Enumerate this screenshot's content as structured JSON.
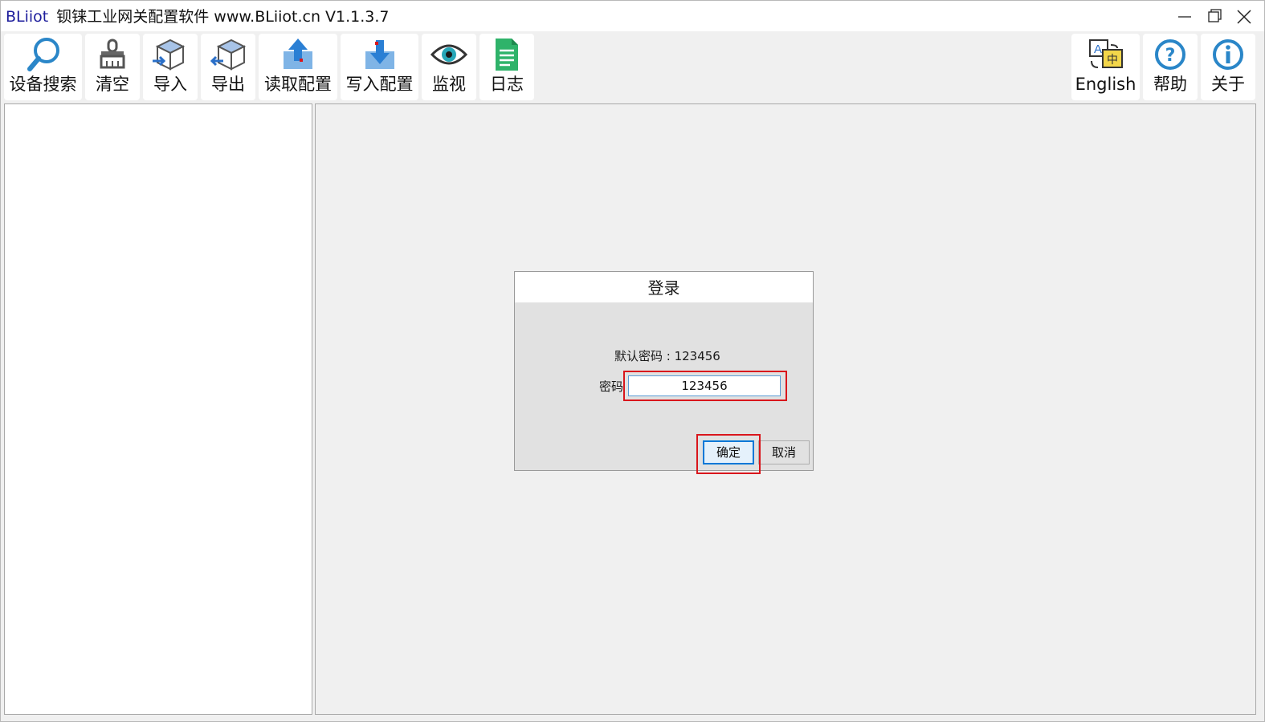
{
  "window": {
    "brand": "BLiiot",
    "title": "钡铼工业网关配置软件 www.BLiiot.cn V1.1.3.7",
    "controls": [
      "minimize-icon",
      "restore-icon",
      "close-icon"
    ]
  },
  "toolbar": {
    "left": [
      {
        "label": "设备搜索",
        "icon": "search-icon"
      },
      {
        "label": "清空",
        "icon": "broom-icon"
      },
      {
        "label": "导入",
        "icon": "import-box-icon"
      },
      {
        "label": "导出",
        "icon": "export-box-icon"
      },
      {
        "label": "读取配置",
        "icon": "upload-arrow-icon"
      },
      {
        "label": "写入配置",
        "icon": "download-arrow-icon"
      },
      {
        "label": "监视",
        "icon": "eye-icon"
      },
      {
        "label": "日志",
        "icon": "document-icon"
      }
    ],
    "right": [
      {
        "label": "English",
        "icon": "translate-icon"
      },
      {
        "label": "帮助",
        "icon": "help-icon"
      },
      {
        "label": "关于",
        "icon": "info-icon"
      }
    ]
  },
  "dialog": {
    "title": "登录",
    "hint": "默认密码 : 123456",
    "password_label": "密码",
    "password_value": "123456",
    "ok_label": "确定",
    "cancel_label": "取消"
  },
  "colors": {
    "highlight": "#d9161c",
    "brand": "#1d1d9c",
    "accent": "#5b9bd5"
  }
}
